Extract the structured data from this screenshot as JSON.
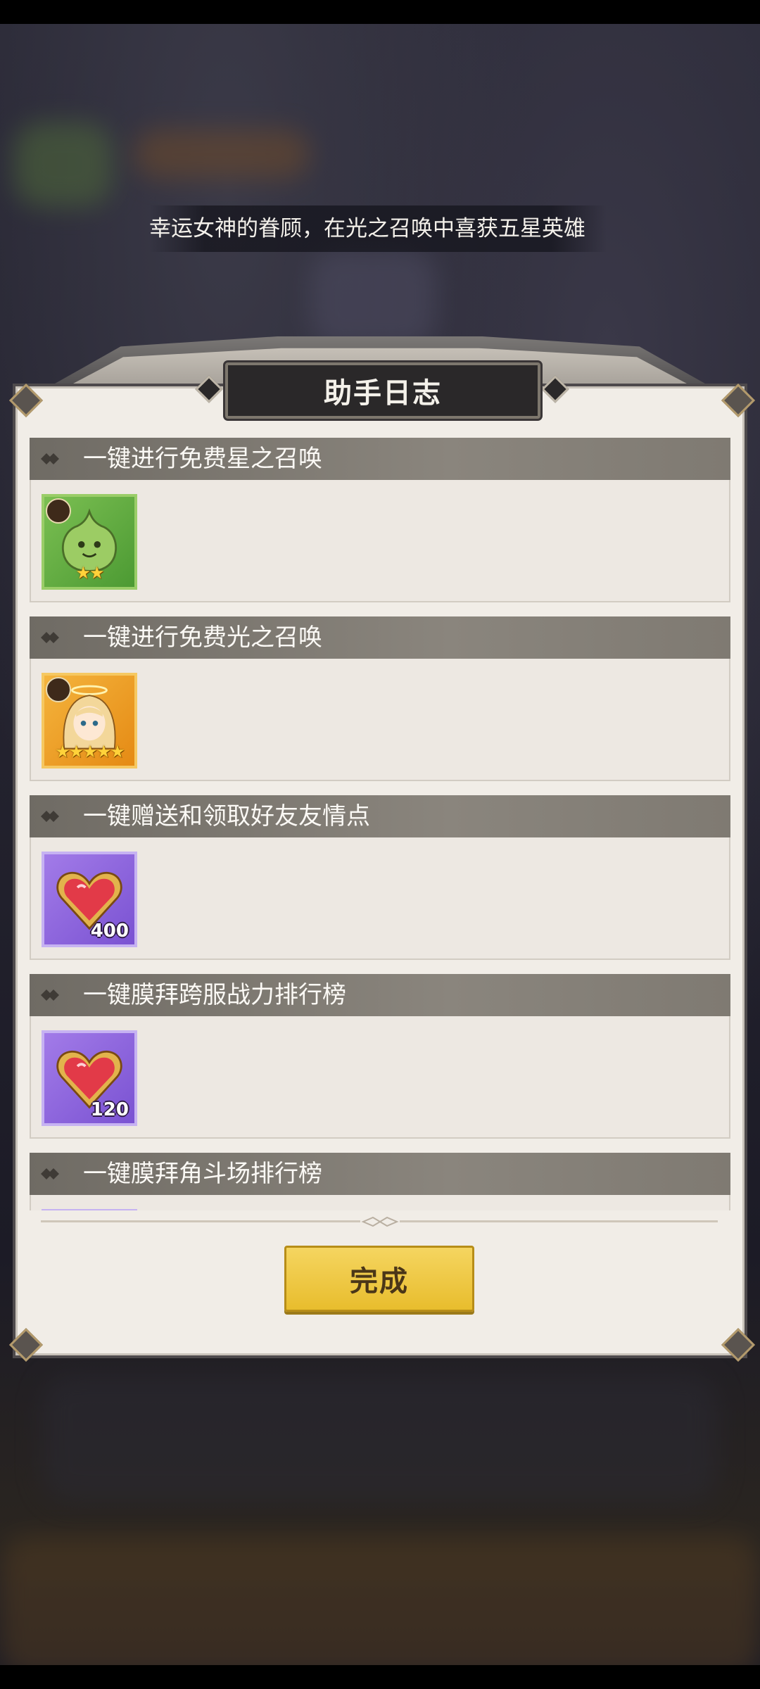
{
  "marquee": {
    "text": "幸运女神的眷顾，在光之召唤中喜获五星英雄"
  },
  "panel": {
    "title": "助手日志"
  },
  "sections": [
    {
      "title": "一键进行免费星之召唤",
      "reward": {
        "icon": "green-slime-hero-icon",
        "stars": 2,
        "star_text": "★★",
        "count": ""
      }
    },
    {
      "title": "一键进行免费光之召唤",
      "reward": {
        "icon": "angel-girl-hero-icon",
        "stars": 5,
        "star_text": "★★★★★",
        "count": ""
      }
    },
    {
      "title": "一键赠送和领取好友友情点",
      "reward": {
        "icon": "friendship-heart-icon",
        "count": "400"
      }
    },
    {
      "title": "一键膜拜跨服战力排行榜",
      "reward": {
        "icon": "friendship-heart-icon",
        "count": "120"
      }
    },
    {
      "title": "一键膜拜角斗场排行榜",
      "reward": {
        "icon": "friendship-heart-icon",
        "count": ""
      }
    }
  ],
  "done_button": {
    "label": "完成"
  },
  "colors": {
    "accent": "#e8bd2d",
    "panel_bg": "#f1ede7",
    "header_bg": "#7f7a72"
  }
}
